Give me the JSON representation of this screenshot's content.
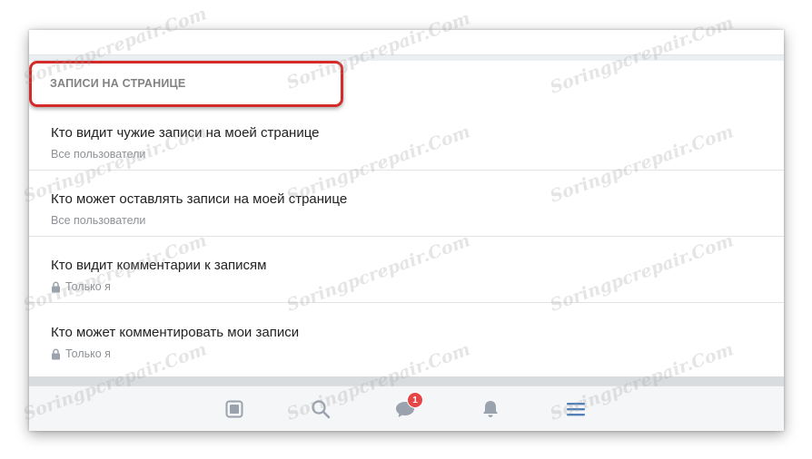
{
  "section": {
    "header": "ЗАПИСИ НА СТРАНИЦЕ"
  },
  "settings": [
    {
      "title": "Кто видит чужие записи на моей странице",
      "value": "Все пользователи",
      "locked": false
    },
    {
      "title": "Кто может оставлять записи на моей странице",
      "value": "Все пользователи",
      "locked": false
    },
    {
      "title": "Кто видит комментарии к записям",
      "value": "Только я",
      "locked": true
    },
    {
      "title": "Кто может комментировать мои записи",
      "value": "Только я",
      "locked": true
    }
  ],
  "tabbar": {
    "tabs": [
      {
        "name": "news",
        "icon": "news-icon"
      },
      {
        "name": "search",
        "icon": "search-icon"
      },
      {
        "name": "messages",
        "icon": "chat-bubble-icon",
        "badge": "1"
      },
      {
        "name": "notifications",
        "icon": "bell-icon"
      },
      {
        "name": "menu",
        "icon": "menu-icon",
        "active": true
      }
    ]
  },
  "colors": {
    "accent": "#5181b8",
    "highlight": "#d42a2a",
    "badge": "#e64646",
    "icon_inactive": "#99a2ad"
  },
  "watermark": "Soringpcrepair.Com"
}
